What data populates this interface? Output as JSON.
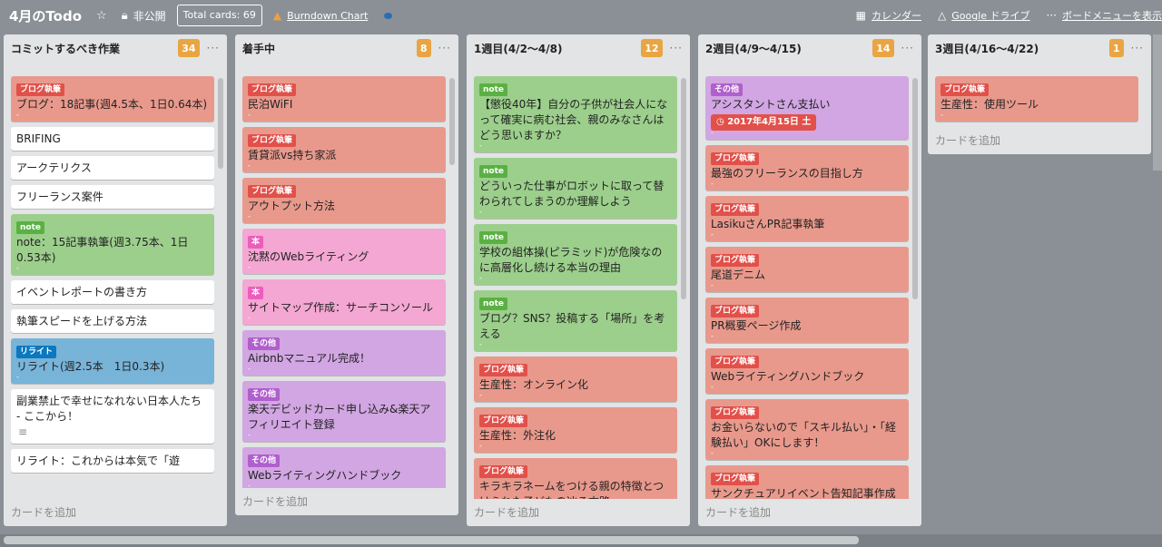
{
  "board": {
    "title": "4月のTodo",
    "visibility": "非公開",
    "total_cards": "Total cards: 69",
    "burndown": "Burndown Chart",
    "calendar": "カレンダー",
    "drive": "Google ドライブ",
    "menu": "ボードメニューを表示"
  },
  "lists": [
    {
      "title": "コミットするべき作業",
      "count": "34",
      "add": "カードを追加",
      "cards": [
        {
          "label": "ブログ執筆",
          "title": "ブログ：18記事(週4.5本、1日0.64本)",
          "color": "red"
        },
        {
          "label": "",
          "title": "BRIFING",
          "color": "white"
        },
        {
          "label": "",
          "title": "アークテリクス",
          "color": "white"
        },
        {
          "label": "",
          "title": "フリーランス案件",
          "color": "white"
        },
        {
          "label": "note",
          "title": "note：15記事執筆(週3.75本、1日0.53本)",
          "color": "green"
        },
        {
          "label": "",
          "title": "イベントレポートの書き方",
          "color": "white"
        },
        {
          "label": "",
          "title": "執筆スピードを上げる方法",
          "color": "white"
        },
        {
          "label": "リライト",
          "title": "リライト(週2.5本　1日0.3本)",
          "color": "blue"
        },
        {
          "label": "",
          "title": "副業禁止で幸せになれない日本人たち - ここから！",
          "color": "white",
          "desc": true
        },
        {
          "label": "",
          "title": "リライト：これからは本気で「遊",
          "color": "white"
        }
      ]
    },
    {
      "title": "着手中",
      "count": "8",
      "add": "カードを追加",
      "cards": [
        {
          "label": "ブログ執筆",
          "title": "民泊WiFI",
          "color": "red"
        },
        {
          "label": "ブログ執筆",
          "title": "賃貸派vs持ち家派",
          "color": "red"
        },
        {
          "label": "ブログ執筆",
          "title": "アウトプット方法",
          "color": "red"
        },
        {
          "label": "本",
          "title": "沈黙のWebライティング",
          "color": "pink"
        },
        {
          "label": "本",
          "title": "サイトマップ作成：サーチコンソール",
          "color": "pink"
        },
        {
          "label": "その他",
          "title": "Airbnbマニュアル完成！",
          "color": "purple"
        },
        {
          "label": "その他",
          "title": "楽天デビッドカード申し込み&楽天アフィリエイト登録",
          "color": "purple"
        },
        {
          "label": "その他",
          "title": "Webライティングハンドブック",
          "color": "purple"
        }
      ]
    },
    {
      "title": "1週目(4/2〜4/8)",
      "count": "12",
      "add": "カードを追加",
      "cards": [
        {
          "label": "note",
          "title": "【懲役40年】自分の子供が社会人になって確実に病む社会、親のみなさんはどう思いますか？",
          "color": "green"
        },
        {
          "label": "note",
          "title": "どういった仕事がロボットに取って替わられてしまうのか理解しよう",
          "color": "green"
        },
        {
          "label": "note",
          "title": "学校の組体操(ピラミッド)が危険なのに高層化し続ける本当の理由",
          "color": "green"
        },
        {
          "label": "note",
          "title": "ブログ？SNS？投稿する「場所」を考える",
          "color": "green"
        },
        {
          "label": "ブログ執筆",
          "title": "生産性：オンライン化",
          "color": "red"
        },
        {
          "label": "ブログ執筆",
          "title": "生産性：外注化",
          "color": "red"
        },
        {
          "label": "ブログ執筆",
          "title": "キラキラネームをつける親の特徴とつけられた子どもの辿る末路",
          "color": "red"
        }
      ]
    },
    {
      "title": "2週目(4/9〜4/15)",
      "count": "14",
      "add": "カードを追加",
      "cards": [
        {
          "label": "その他",
          "title": "アシスタントさん支払い",
          "color": "purple",
          "due": "2017年4月15日 土"
        },
        {
          "label": "ブログ執筆",
          "title": "最強のフリーランスの目指し方",
          "color": "red"
        },
        {
          "label": "ブログ執筆",
          "title": "LasikuさんPR記事執筆",
          "color": "red"
        },
        {
          "label": "ブログ執筆",
          "title": "尾道デニム",
          "color": "red"
        },
        {
          "label": "ブログ執筆",
          "title": "PR概要ページ作成",
          "color": "red"
        },
        {
          "label": "ブログ執筆",
          "title": "Webライティングハンドブック",
          "color": "red"
        },
        {
          "label": "ブログ執筆",
          "title": "お金いらないので「スキル払い」・「経験払い」OKにします！",
          "color": "red"
        },
        {
          "label": "ブログ執筆",
          "title": "サンクチュアリイベント告知記事作成",
          "color": "red"
        }
      ]
    },
    {
      "title": "3週目(4/16〜4/22)",
      "count": "1",
      "add": "カードを追加",
      "cards": [
        {
          "label": "ブログ執筆",
          "title": "生産性：使用ツール",
          "color": "red"
        }
      ]
    }
  ]
}
